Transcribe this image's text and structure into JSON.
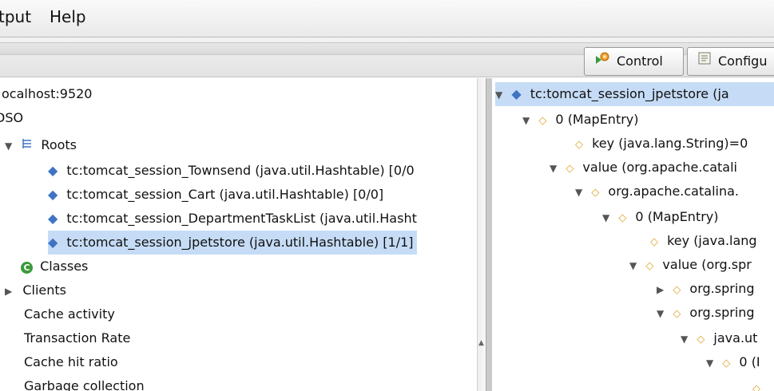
{
  "menubar": {
    "items": [
      "tput",
      "Help"
    ]
  },
  "toolbar": {
    "control_label": "Control",
    "configure_label": "Configu"
  },
  "left_tree": {
    "server": "ocalhost:9520",
    "dso": "DSO",
    "roots_label": "Roots",
    "roots": [
      "tc:tomcat_session_Townsend (java.util.Hashtable) [0/0",
      "tc:tomcat_session_Cart (java.util.Hashtable) [0/0]",
      "tc:tomcat_session_DepartmentTaskList (java.util.Hasht",
      "tc:tomcat_session_jpetstore (java.util.Hashtable) [1/1]"
    ],
    "classes_label": "Classes",
    "clients_label": "Clients",
    "stats": [
      "Cache activity",
      "Transaction Rate",
      "Cache hit ratio",
      "Garbage collection"
    ]
  },
  "right_tree": {
    "root": "tc:tomcat_session_jpetstore (ja",
    "n1": "0 (MapEntry)",
    "n1_key": "key (java.lang.String)=0",
    "n1_value": "value (org.apache.catali",
    "n2": "org.apache.catalina.",
    "n3": "0 (MapEntry)",
    "n3_key": "key (java.lang",
    "n3_value": "value (org.spr",
    "n4a": "org.spring",
    "n4b": "org.spring",
    "n5": "java.ut",
    "n6": "0 (I"
  },
  "colors": {
    "selection": "#c6dcf6",
    "diamond_blue": "#3f73c4",
    "diamond_orange": "#e0a228"
  }
}
